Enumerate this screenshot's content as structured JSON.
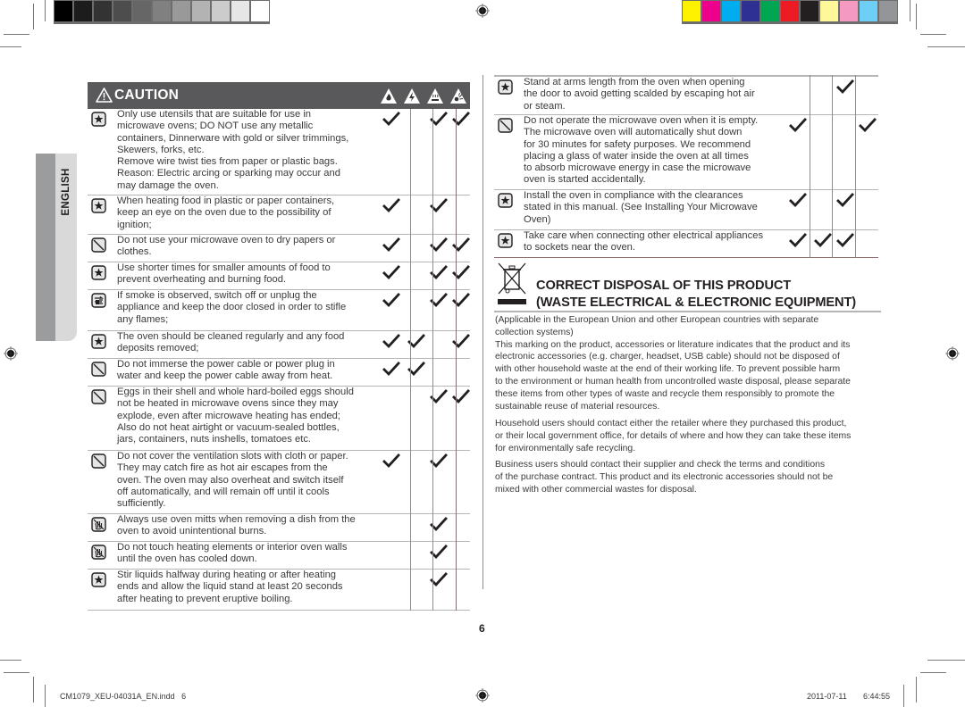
{
  "print_marks": {
    "gray_swatches": [
      "#000000",
      "#1c1c1c",
      "#333333",
      "#4d4d4d",
      "#666666",
      "#808080",
      "#999999",
      "#b3b3b3",
      "#cccccc",
      "#e6e6e6",
      "#ffffff"
    ],
    "color_swatches": [
      "#fff200",
      "#ec008c",
      "#00aeef",
      "#2e3192",
      "#00a651",
      "#ed1c24",
      "#231f20",
      "#fff799",
      "#f49ac1",
      "#6dcff6",
      "#939598"
    ]
  },
  "side_tab": {
    "label": "ENGLISH"
  },
  "caution": {
    "title": "CAUTION",
    "hazard_icons": [
      "fire-hazard",
      "electric-shock-hazard",
      "hot-surface-hazard",
      "explosion-hazard"
    ],
    "rows_left": [
      {
        "icon": "star",
        "text": "Only use utensils that are suitable for use in\nmicrowave ovens; DO NOT use any metallic\ncontainers, Dinnerware with gold or silver trimmings,\nSkewers, forks, etc.\nRemove wire twist ties from paper or plastic bags.\nReason: Electric arcing or sparking may occur and\nmay damage the oven.",
        "checks": [
          true,
          false,
          true,
          true
        ]
      },
      {
        "icon": "star",
        "text": "When heating food in plastic or paper containers,\nkeep an eye on the oven due to the possibility of\nignition;",
        "checks": [
          true,
          false,
          true,
          false
        ]
      },
      {
        "icon": "prohibited",
        "text": "Do not use your microwave oven to dry papers or\nclothes.",
        "checks": [
          true,
          false,
          true,
          true
        ]
      },
      {
        "icon": "star",
        "text": "Use shorter times for smaller amounts of food to\nprevent overheating and burning food.",
        "checks": [
          true,
          false,
          true,
          true
        ]
      },
      {
        "icon": "unplug",
        "text": "If smoke is observed, switch off or unplug the\nappliance and keep the door closed in order to stifle\nany flames;",
        "checks": [
          true,
          false,
          true,
          true
        ]
      },
      {
        "icon": "star",
        "text": "The oven should be cleaned regularly and any food\ndeposits removed;",
        "checks": [
          true,
          true,
          false,
          true
        ]
      },
      {
        "icon": "prohibited",
        "text": "Do not immerse the power cable or power plug in\nwater and keep the power cable away from heat.",
        "checks": [
          true,
          true,
          false,
          false
        ]
      },
      {
        "icon": "prohibited",
        "text": "Eggs in their shell and whole hard-boiled eggs should\nnot be heated in microwave ovens since they may\nexplode, even after microwave heating has ended;\nAlso do not heat airtight or vacuum-sealed bottles,\njars, containers, nuts inshells, tomatoes etc.",
        "checks": [
          false,
          false,
          true,
          true
        ]
      },
      {
        "icon": "prohibited",
        "text": "Do not cover the ventilation slots with cloth or paper.\nThey may catch fire as hot air escapes from the\noven. The oven may also overheat and switch itself\noff automatically, and will remain off until it cools\nsufficiently.",
        "checks": [
          true,
          false,
          true,
          false
        ]
      },
      {
        "icon": "no-touch",
        "text": "Always use oven mitts when removing a dish from the\noven to avoid unintentional burns.",
        "checks": [
          false,
          false,
          true,
          false
        ]
      },
      {
        "icon": "no-touch",
        "text": "Do not touch heating elements or interior oven walls\nuntil the oven has cooled down.",
        "checks": [
          false,
          false,
          true,
          false
        ]
      },
      {
        "icon": "star",
        "text": "Stir liquids halfway during heating or after heating\nends and allow the liquid stand at least 20 seconds\nafter heating to prevent eruptive boiling.",
        "checks": [
          false,
          false,
          true,
          false
        ]
      }
    ],
    "rows_right": [
      {
        "icon": "star",
        "text": "Stand at arms length from the oven when opening\nthe door to avoid getting scalded by escaping hot air\nor steam.",
        "checks": [
          false,
          false,
          true,
          false
        ]
      },
      {
        "icon": "prohibited",
        "text": "Do not operate the microwave oven when it is empty.\nThe microwave oven will automatically shut down\nfor 30 minutes for safety purposes. We recommend\nplacing a glass of water inside the oven at all times\nto absorb microwave energy in case the microwave\noven is started accidentally.",
        "checks": [
          true,
          false,
          false,
          true
        ]
      },
      {
        "icon": "star",
        "text": "Install the oven in compliance with the clearances\nstated in this manual. (See Installing Your Microwave\nOven)",
        "checks": [
          true,
          false,
          true,
          false
        ]
      },
      {
        "icon": "star",
        "text": "Take care when connecting other electrical appliances\nto sockets near the oven.",
        "checks": [
          true,
          true,
          true,
          false
        ]
      }
    ]
  },
  "disposal": {
    "title_line1": "CORRECT DISPOSAL OF THIS PRODUCT",
    "title_line2": "(WASTE ELECTRICAL & ELECTRONIC EQUIPMENT)",
    "paragraph1": "(Applicable in the European Union and other European countries with separate\ncollection systems)\nThis marking on the product, accessories or literature indicates that the product and its\nelectronic accessories (e.g. charger, headset, USB cable) should not be disposed of\nwith other household waste at the end of their working life. To prevent possible harm\nto the environment or human health from uncontrolled waste disposal, please separate\nthese items from other types of waste and recycle them responsibly to promote the\nsustainable reuse of material resources.",
    "paragraph2": "Household users should contact either the retailer where they purchased this product,\nor their local government office, for details of where and how they can take these items\nfor environmentally safe recycling.",
    "paragraph3": "Business users should contact their supplier and check the terms and conditions\nof the purchase contract. This product and its electronic accessories should not be\nmixed with other commercial wastes for disposal."
  },
  "page_number": "6",
  "footer": {
    "filename": "CM1079_XEU-04031A_EN.indd   6",
    "date": "2011-07-11",
    "time": "6:44:55"
  }
}
